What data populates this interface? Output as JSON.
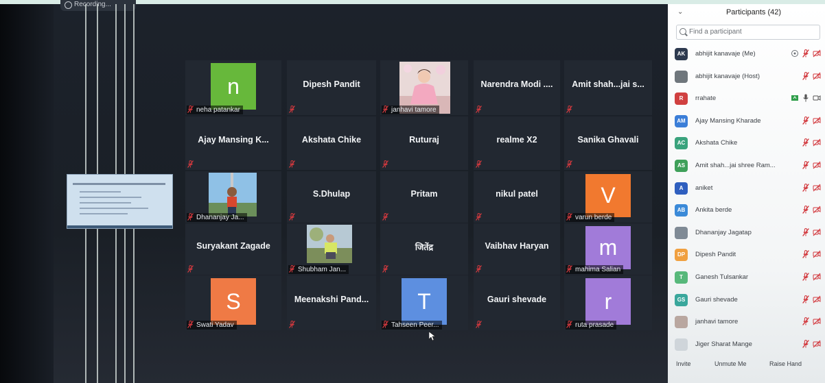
{
  "recording": {
    "label": "Recording..."
  },
  "tiles": [
    {
      "name": "",
      "label": "neha patankar",
      "avatar": "n",
      "avatar_color": "#67b83b",
      "row": 0,
      "col": 0
    },
    {
      "name": "Dipesh Pandit",
      "label": "",
      "row": 0,
      "col": 1
    },
    {
      "name": "",
      "label": "janhavi tamore",
      "photo": "photo-girl",
      "row": 0,
      "col": 2
    },
    {
      "name": "Narendra Modi ....",
      "label": "",
      "row": 0,
      "col": 3
    },
    {
      "name": "Amit shah...jai s...",
      "label": "",
      "row": 0,
      "col": 4
    },
    {
      "name": "Ajay Mansing K...",
      "label": "",
      "row": 1,
      "col": 0
    },
    {
      "name": "Akshata Chike",
      "label": "",
      "row": 1,
      "col": 1
    },
    {
      "name": "Ruturaj",
      "label": "",
      "row": 1,
      "col": 2
    },
    {
      "name": "realme X2",
      "label": "",
      "row": 1,
      "col": 3
    },
    {
      "name": "Sanika Ghavali",
      "label": "",
      "row": 1,
      "col": 4
    },
    {
      "name": "",
      "label": "Dhananjay Ja...",
      "photo": "photo-man",
      "row": 2,
      "col": 0
    },
    {
      "name": "S.Dhulap",
      "label": "",
      "row": 2,
      "col": 1
    },
    {
      "name": "Pritam",
      "label": "",
      "row": 2,
      "col": 2
    },
    {
      "name": "nikul patel",
      "label": "",
      "row": 2,
      "col": 3
    },
    {
      "name": "",
      "label": "varun berde",
      "avatar": "V",
      "avatar_color": "#f1792f",
      "row": 2,
      "col": 4
    },
    {
      "name": "Suryakant Zagade",
      "label": "",
      "row": 3,
      "col": 0
    },
    {
      "name": "",
      "label": "Shubham Jan...",
      "photo": "photo-outdoor",
      "row": 3,
      "col": 1
    },
    {
      "name": "जितेंद्र",
      "label": "",
      "row": 3,
      "col": 2
    },
    {
      "name": "Vaibhav Haryan",
      "label": "",
      "row": 3,
      "col": 3
    },
    {
      "name": "",
      "label": "mahima Salian",
      "avatar": "m",
      "avatar_color": "#a17bd9",
      "row": 3,
      "col": 4
    },
    {
      "name": "",
      "label": "Swati Yadav",
      "avatar": "S",
      "avatar_color": "#ef7a45",
      "row": 4,
      "col": 0
    },
    {
      "name": "Meenakshi Pand...",
      "label": "",
      "row": 4,
      "col": 1
    },
    {
      "name": "",
      "label": "Tahseen Peer...",
      "avatar": "T",
      "avatar_color": "#5d8fe0",
      "row": 4,
      "col": 2
    },
    {
      "name": "Gauri shevade",
      "label": "",
      "row": 4,
      "col": 3
    },
    {
      "name": "",
      "label": "ruta prasade",
      "avatar": "r",
      "avatar_color": "#a17bd9",
      "row": 4,
      "col": 4
    }
  ],
  "panel": {
    "title": "Participants (42)",
    "search_placeholder": "Find a participant",
    "participants": [
      {
        "initials": "AK",
        "name": "abhijit kanavaje (Me)",
        "color": "#2d3a4f",
        "icons": [
          "share-icon",
          "muted-mic-icon",
          "video-off-icon"
        ]
      },
      {
        "initials": "",
        "name": "abhijit kanavaje (Host)",
        "color": "#6f767c",
        "icons": [
          "muted-mic-icon",
          "video-off-icon"
        ]
      },
      {
        "initials": "R",
        "name": "rrahate",
        "color": "#d04040",
        "icons": [
          "screen-icon",
          "mic-icon",
          "video-icon"
        ]
      },
      {
        "initials": "AM",
        "name": "Ajay Mansing Kharade",
        "color": "#3b7ed8",
        "icons": [
          "muted-mic-icon",
          "video-off-icon"
        ]
      },
      {
        "initials": "AC",
        "name": "Akshata Chike",
        "color": "#3aa37d",
        "icons": [
          "muted-mic-icon",
          "video-off-icon"
        ]
      },
      {
        "initials": "AS",
        "name": "Amit shah...jai shree Ram...",
        "color": "#3fa05a",
        "icons": [
          "muted-mic-icon",
          "video-off-icon"
        ]
      },
      {
        "initials": "A",
        "name": "aniket",
        "color": "#2f5fbf",
        "icons": [
          "muted-mic-icon",
          "video-off-icon"
        ]
      },
      {
        "initials": "AB",
        "name": "Ankita berde",
        "color": "#3b8ad8",
        "icons": [
          "muted-mic-icon",
          "video-off-icon"
        ]
      },
      {
        "initials": "",
        "name": "Dhananjay Jagatap",
        "color": "#7f8a95",
        "icons": [
          "muted-mic-icon",
          "video-off-icon"
        ]
      },
      {
        "initials": "DP",
        "name": "Dipesh Pandit",
        "color": "#f0a040",
        "icons": [
          "muted-mic-icon",
          "video-off-icon"
        ]
      },
      {
        "initials": "T",
        "name": "Ganesh Tulsankar",
        "color": "#57b87a",
        "icons": [
          "muted-mic-icon",
          "video-off-icon"
        ]
      },
      {
        "initials": "GS",
        "name": "Gauri shevade",
        "color": "#3aa79c",
        "icons": [
          "muted-mic-icon",
          "video-off-icon"
        ]
      },
      {
        "initials": "",
        "name": "janhavi tamore",
        "color": "#b9a7a0",
        "icons": [
          "muted-mic-icon",
          "video-off-icon"
        ]
      },
      {
        "initials": "",
        "name": "Jiger Sharat Mange",
        "color": "#cfd5da",
        "icons": [
          "muted-mic-icon",
          "video-off-icon"
        ]
      }
    ],
    "footer": {
      "invite": "Invite",
      "unmute": "Unmute Me",
      "raise": "Raise Hand"
    }
  },
  "colors": {
    "muted": "#d2393e",
    "tile_bg": "#222831"
  }
}
